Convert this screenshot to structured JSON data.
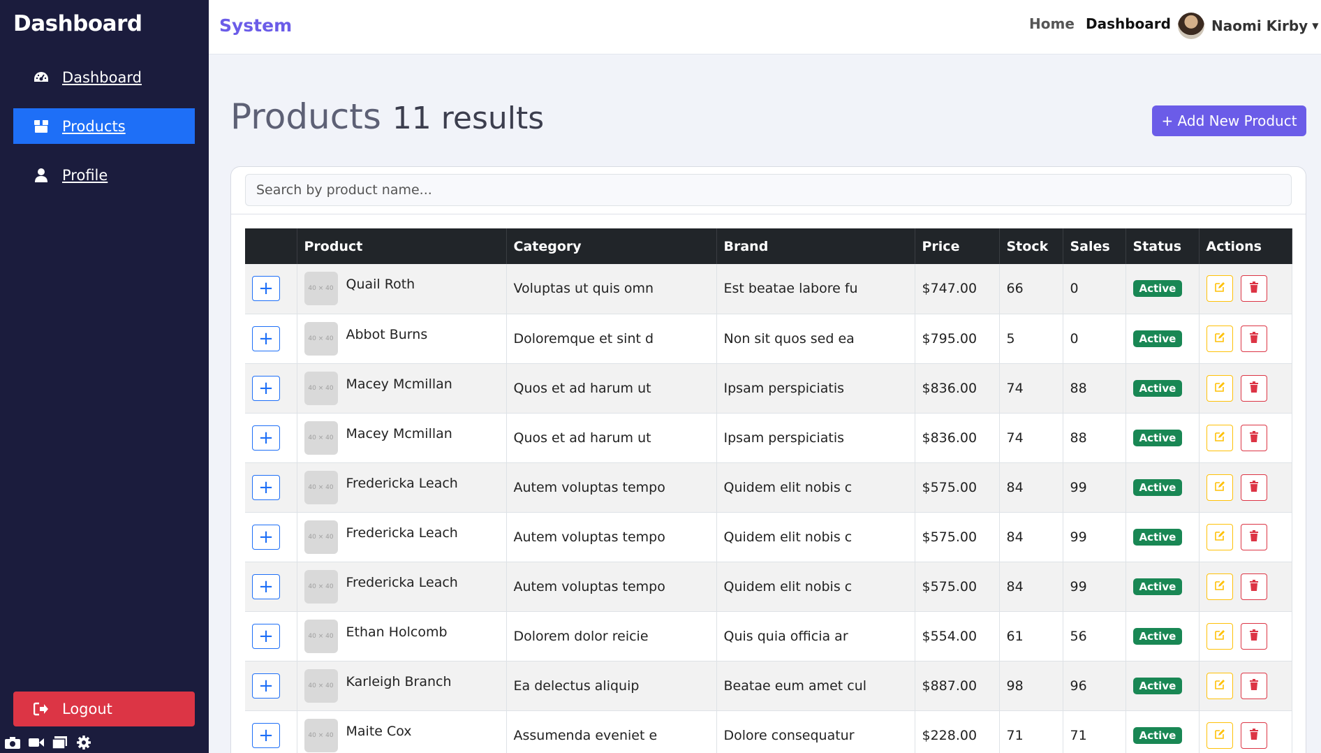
{
  "sidebar": {
    "brand": "Dashboard",
    "items": [
      {
        "label": "Dashboard",
        "icon": "gauge-icon"
      },
      {
        "label": "Products",
        "icon": "box-icon",
        "active": true
      },
      {
        "label": "Profile",
        "icon": "user-icon"
      }
    ],
    "logout_label": "Logout"
  },
  "topbar": {
    "title": "System",
    "home_label": "Home",
    "dashboard_label": "Dashboard",
    "user_name": "Naomi Kirby"
  },
  "main": {
    "title": "Products",
    "results": "11 results",
    "add_button": "+ Add New Product",
    "search_placeholder": "Search by product name..."
  },
  "table": {
    "headers": [
      "",
      "Product",
      "Category",
      "Brand",
      "Price",
      "Stock",
      "Sales",
      "Status",
      "Actions"
    ],
    "thumb_label": "40 × 40",
    "rows": [
      {
        "product": "Quail Roth",
        "category": "Voluptas ut quis omn",
        "brand": "Est beatae labore fu",
        "price": "$747.00",
        "stock": "66",
        "sales": "0",
        "status": "Active"
      },
      {
        "product": "Abbot Burns",
        "category": "Doloremque et sint d",
        "brand": "Non sit quos sed ea",
        "price": "$795.00",
        "stock": "5",
        "sales": "0",
        "status": "Active"
      },
      {
        "product": "Macey Mcmillan",
        "category": "Quos et ad harum ut",
        "brand": "Ipsam perspiciatis",
        "price": "$836.00",
        "stock": "74",
        "sales": "88",
        "status": "Active"
      },
      {
        "product": "Macey Mcmillan",
        "category": "Quos et ad harum ut",
        "brand": "Ipsam perspiciatis",
        "price": "$836.00",
        "stock": "74",
        "sales": "88",
        "status": "Active"
      },
      {
        "product": "Fredericka Leach",
        "category": "Autem voluptas tempo",
        "brand": "Quidem elit nobis c",
        "price": "$575.00",
        "stock": "84",
        "sales": "99",
        "status": "Active"
      },
      {
        "product": "Fredericka Leach",
        "category": "Autem voluptas tempo",
        "brand": "Quidem elit nobis c",
        "price": "$575.00",
        "stock": "84",
        "sales": "99",
        "status": "Active"
      },
      {
        "product": "Fredericka Leach",
        "category": "Autem voluptas tempo",
        "brand": "Quidem elit nobis c",
        "price": "$575.00",
        "stock": "84",
        "sales": "99",
        "status": "Active"
      },
      {
        "product": "Ethan Holcomb",
        "category": "Dolorem dolor reicie",
        "brand": "Quis quia officia ar",
        "price": "$554.00",
        "stock": "61",
        "sales": "56",
        "status": "Active"
      },
      {
        "product": "Karleigh Branch",
        "category": "Ea delectus aliquip",
        "brand": "Beatae eum amet cul",
        "price": "$887.00",
        "stock": "98",
        "sales": "96",
        "status": "Active"
      },
      {
        "product": "Maite Cox",
        "category": "Assumenda eveniet e",
        "brand": "Dolore consequatur",
        "price": "$228.00",
        "stock": "71",
        "sales": "71",
        "status": "Active"
      }
    ]
  },
  "colors": {
    "sidebar_bg": "#1b1c3d",
    "active_nav": "#1e6ff7",
    "accent": "#6b5ce8",
    "logout": "#dc3545",
    "status_active": "#198754",
    "edit": "#ffc107"
  }
}
